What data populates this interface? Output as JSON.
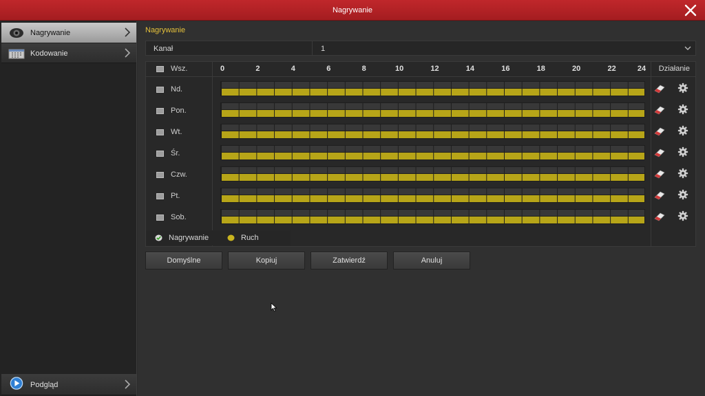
{
  "window": {
    "title": "Nagrywanie"
  },
  "sidebar": {
    "items": [
      {
        "label": "Nagrywanie",
        "icon": "camera-icon"
      },
      {
        "label": "Kodowanie",
        "icon": "encoding-icon"
      }
    ],
    "bottom": {
      "label": "Podgląd",
      "icon": "preview-icon"
    }
  },
  "main": {
    "section_title": "Nagrywanie",
    "channel": {
      "label": "Kanał",
      "value": "1"
    },
    "schedule": {
      "select_all_label": "Wsz.",
      "hours": [
        "0",
        "2",
        "4",
        "6",
        "8",
        "10",
        "12",
        "14",
        "16",
        "18",
        "20",
        "22",
        "24"
      ],
      "action_header": "Działanie",
      "days": [
        "Nd.",
        "Pon.",
        "Wt.",
        "Śr.",
        "Czw.",
        "Pt.",
        "Sob."
      ]
    },
    "legend": {
      "recording": "Nagrywanie",
      "motion": "Ruch"
    },
    "buttons": {
      "default": "Domyślne",
      "copy": "Kopiuj",
      "confirm": "Zatwierdź",
      "cancel": "Anuluj"
    }
  },
  "colors": {
    "title_bar": "#b32024",
    "accent_text": "#e5c13b",
    "motion": "#b7a518",
    "recording": "#6cbf2a"
  }
}
